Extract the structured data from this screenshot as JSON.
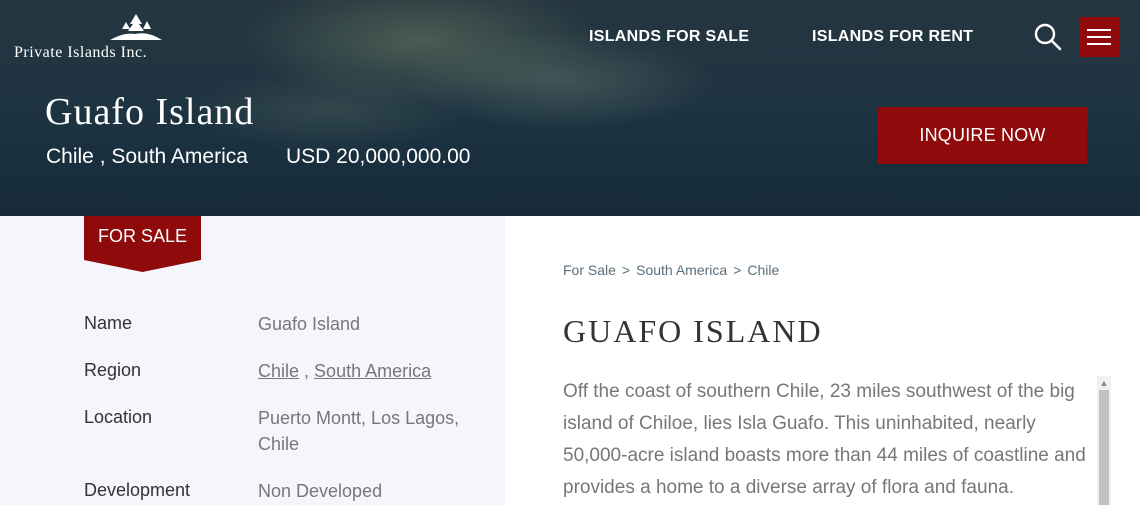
{
  "logo": {
    "text": "Private Islands Inc."
  },
  "nav": {
    "islands_for_sale": "ISLANDS FOR SALE",
    "islands_for_rent": "ISLANDS FOR RENT"
  },
  "hero": {
    "title": "Guafo Island",
    "location": "Chile , South America",
    "price": "USD 20,000,000.00",
    "inquire_label": "INQUIRE NOW"
  },
  "badge": {
    "label": "FOR SALE"
  },
  "info": {
    "name_label": "Name",
    "name_value": "Guafo Island",
    "region_label": "Region",
    "region_country": "Chile",
    "region_separator": " , ",
    "region_continent": "South America",
    "location_label": "Location",
    "location_value": "Puerto Montt, Los Lagos, Chile",
    "development_label": "Development",
    "development_value": "Non Developed"
  },
  "breadcrumb": {
    "items": [
      "For Sale",
      "South America",
      "Chile"
    ],
    "separator": ">"
  },
  "content": {
    "title": "GUAFO ISLAND",
    "description": "Off the coast of southern Chile, 23 miles southwest of the big island of Chiloe, lies Isla Guafo. This uninhabited, nearly 50,000-acre island boasts more than 44 miles of coastline and provides a home to a diverse array of flora and fauna."
  },
  "colors": {
    "accent": "#8f0b0b",
    "panel_bg": "#f4f6fb"
  },
  "icons": {
    "search": "search-icon",
    "menu": "hamburger-icon",
    "logo": "island-tree-icon"
  }
}
